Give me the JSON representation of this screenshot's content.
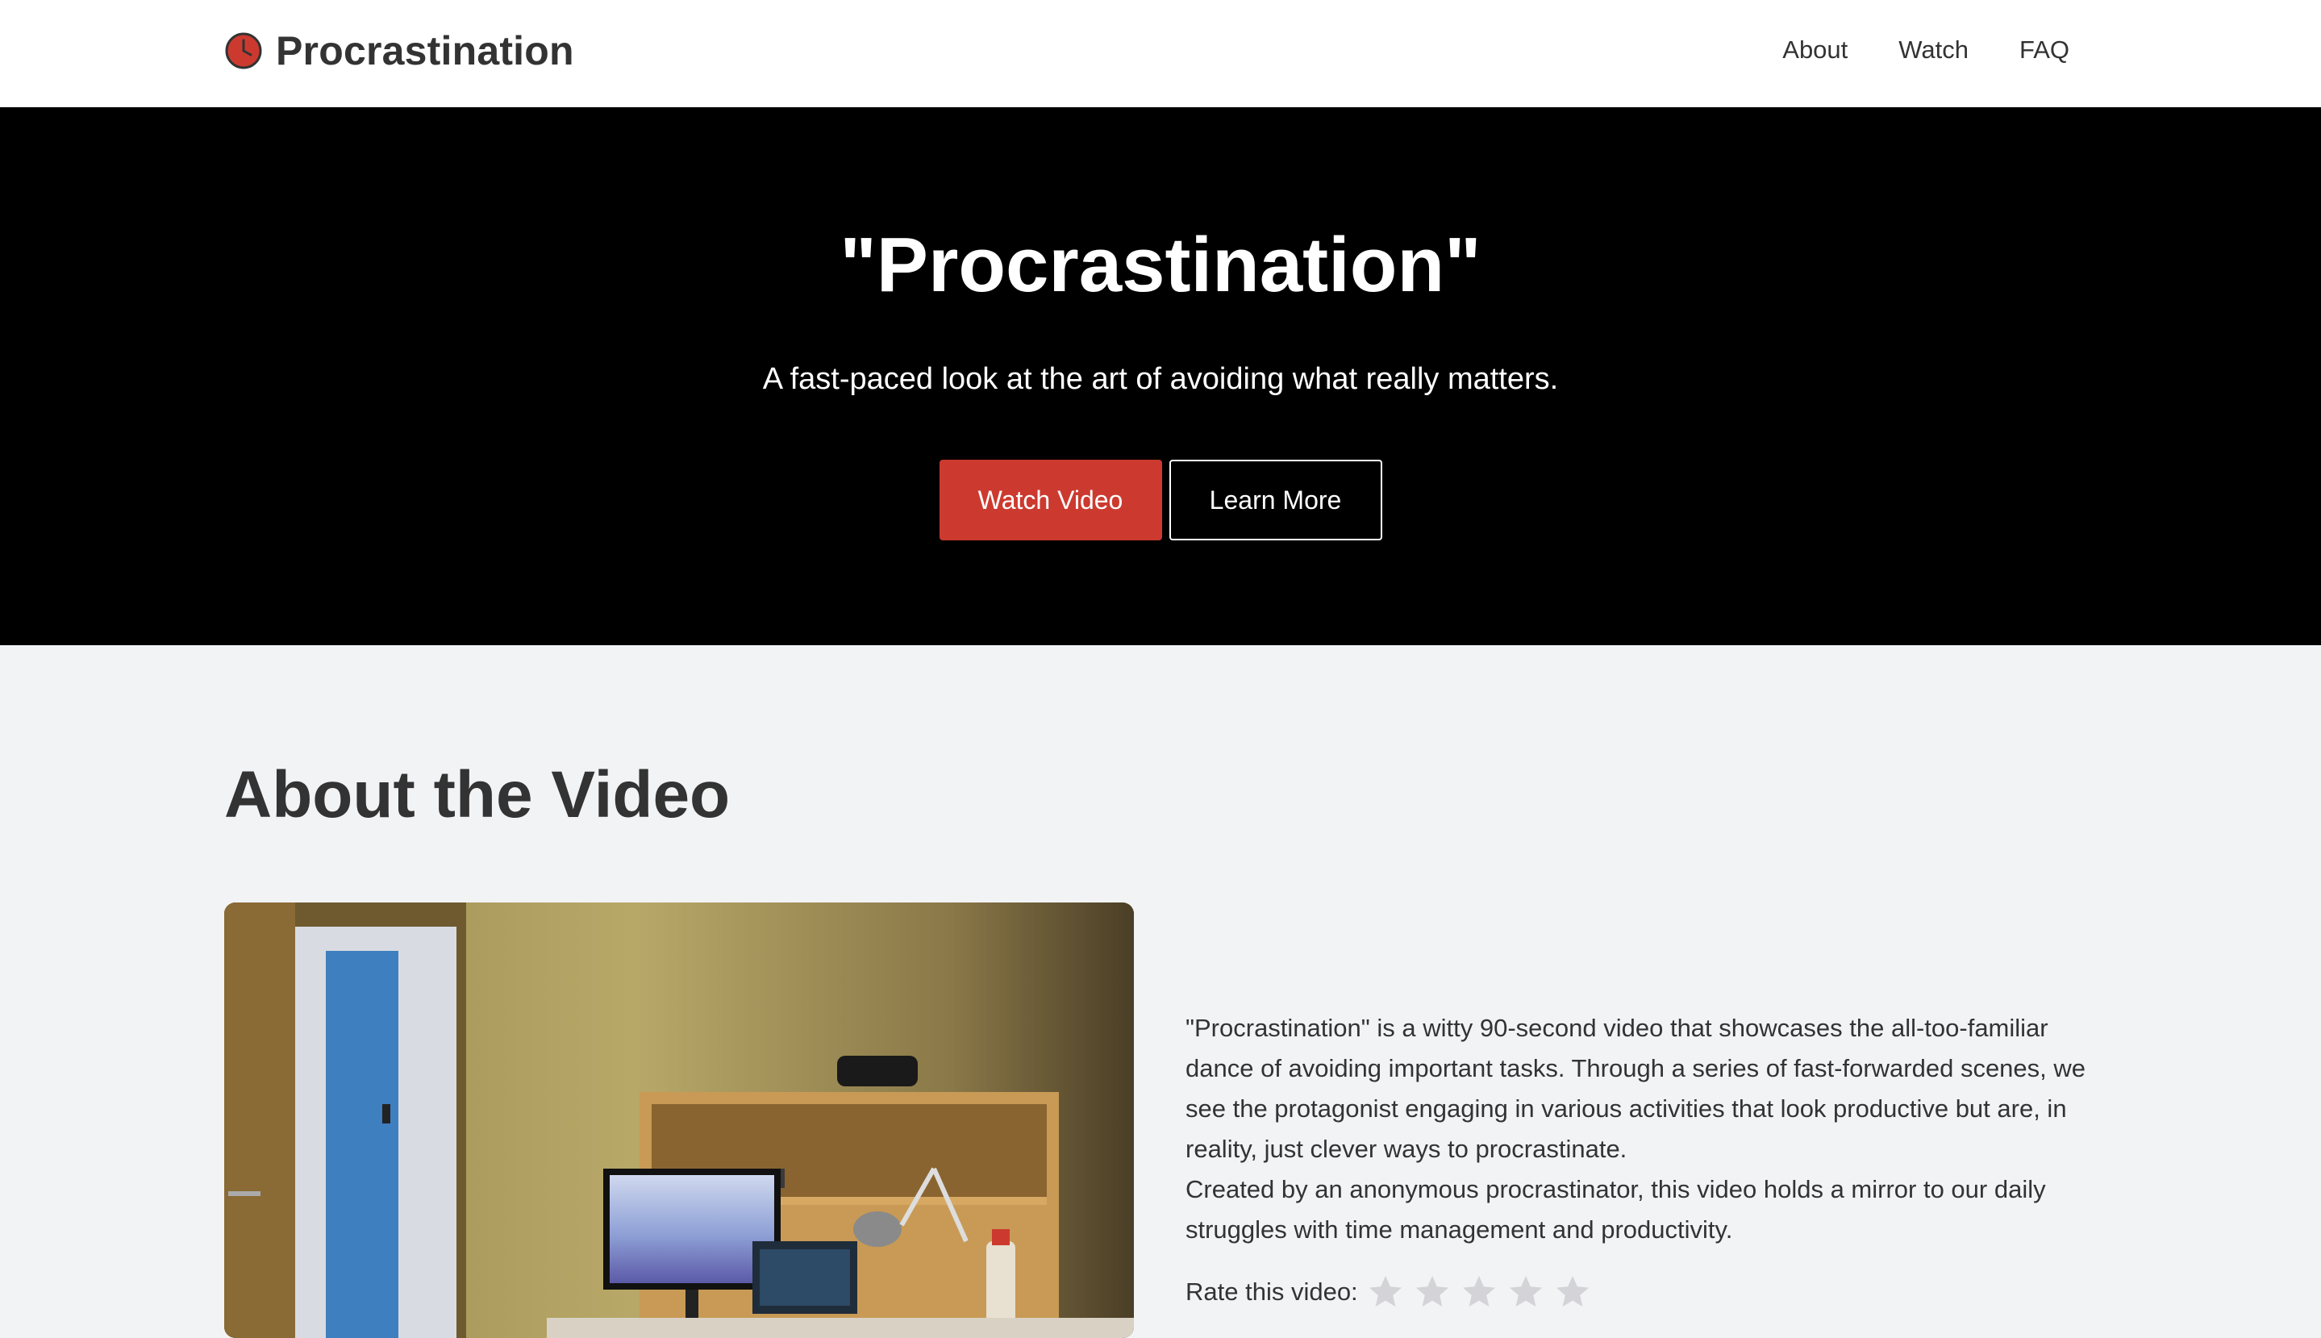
{
  "header": {
    "brand": "Procrastination",
    "brand_icon": "clock-icon",
    "nav": [
      "About",
      "Watch",
      "FAQ"
    ]
  },
  "hero": {
    "title": "\"Procrastination\"",
    "subtitle": "A fast-paced look at the art of avoiding what really matters.",
    "primary_button": "Watch Video",
    "secondary_button": "Learn More"
  },
  "about": {
    "title": "About the Video",
    "paragraph_1": "\"Procrastination\" is a witty 90-second video that showcases the all-too-familiar dance of avoiding important tasks. Through a series of fast-forwarded scenes, we see the protagonist engaging in various activities that look productive but are, in reality, just clever ways to procrastinate.",
    "paragraph_2": "Created by an anonymous procrastinator, this video holds a mirror to our daily struggles with time management and productivity.",
    "rating_label": "Rate this video:",
    "rating_max": 5,
    "rating_value": 0
  },
  "colors": {
    "accent": "#cc3a2f",
    "hero_bg": "#000000",
    "page_bg": "#f2f3f5",
    "text": "#333333",
    "star_empty": "#d3d3d8"
  }
}
